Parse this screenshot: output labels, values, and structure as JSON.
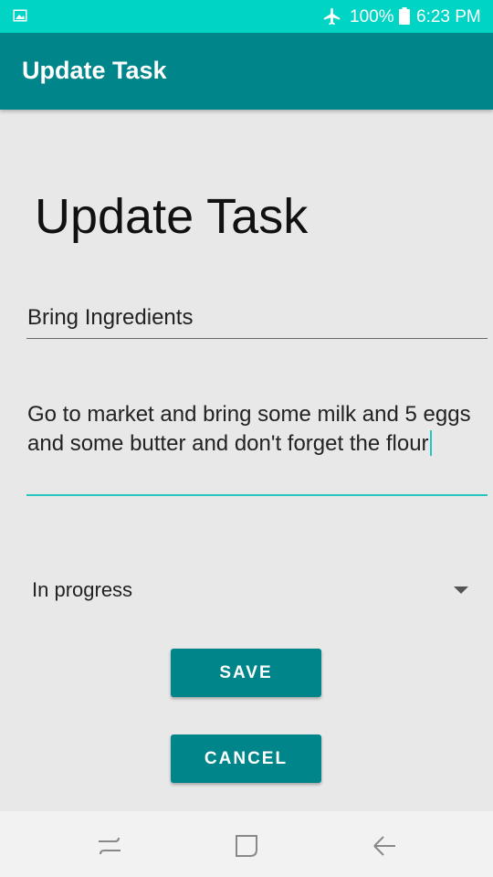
{
  "status_bar": {
    "battery_percent": "100%",
    "time": "6:23 PM",
    "icons": [
      "image-icon",
      "airplane-mode-icon",
      "battery-icon"
    ]
  },
  "app_bar": {
    "title": "Update Task"
  },
  "form": {
    "heading": "Update Task",
    "task_title": "Bring Ingredients",
    "task_description": "Go to market and bring some milk and 5 eggs and some butter and don't forget the flour",
    "status": "In progress"
  },
  "buttons": {
    "save": "SAVE",
    "cancel": "CANCEL"
  },
  "nav_bar": {
    "icons": [
      "recent-apps-icon",
      "home-icon",
      "back-icon"
    ]
  },
  "colors": {
    "status_bar": "#00d4c4",
    "primary": "#00868a",
    "accent": "#26c6be",
    "background": "#e8e8e8"
  }
}
